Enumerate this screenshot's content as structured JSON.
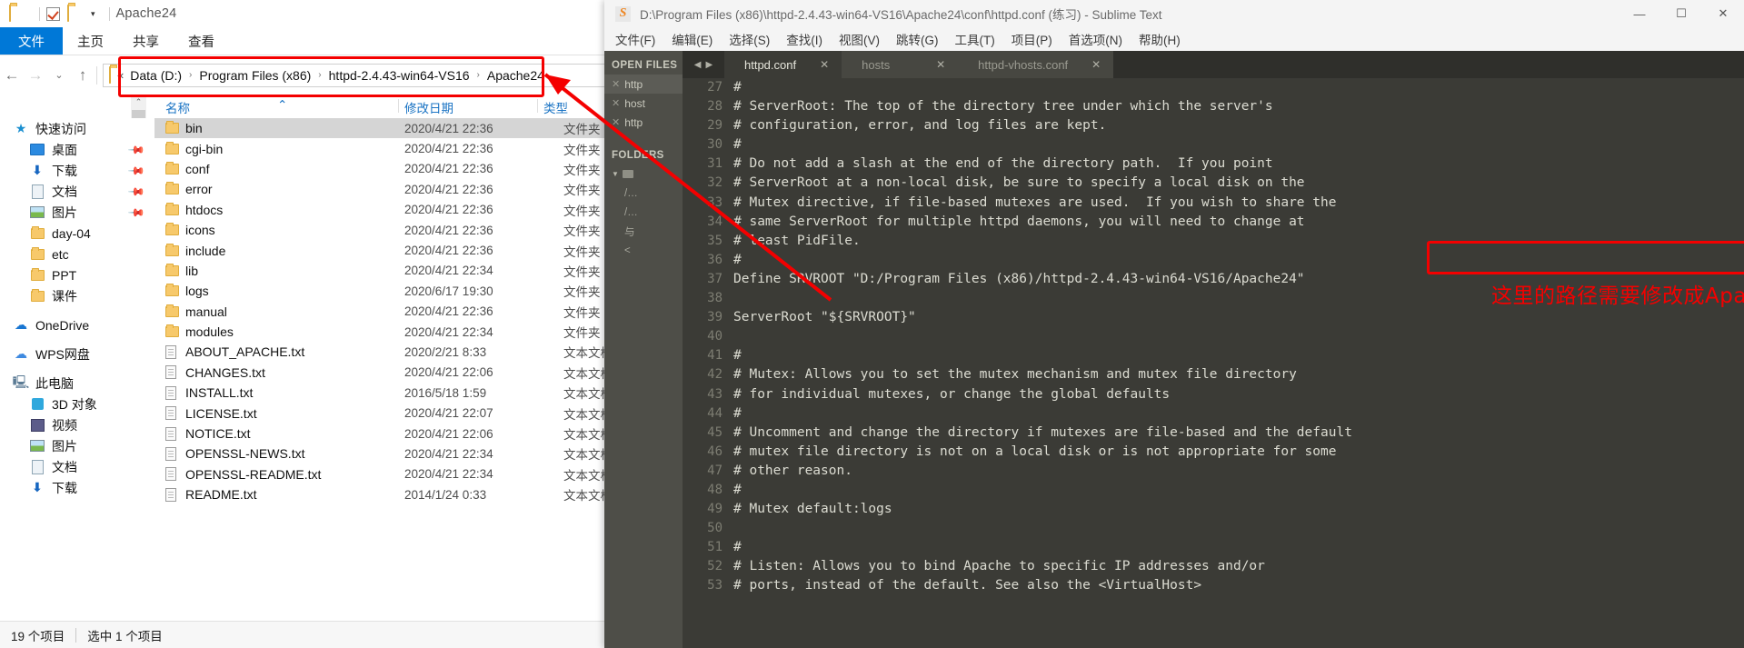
{
  "explorer": {
    "quick_access_toolbar": {
      "title": "Apache24"
    },
    "ribbon_tabs": [
      {
        "label": "文件",
        "active": true
      },
      {
        "label": "主页",
        "active": false
      },
      {
        "label": "共享",
        "active": false
      },
      {
        "label": "查看",
        "active": false
      }
    ],
    "address_bar": {
      "lead": "«",
      "crumbs": [
        "Data (D:)",
        "Program Files (x86)",
        "httpd-2.4.43-win64-VS16",
        "Apache24"
      ],
      "separator": "›",
      "dropdown": "⌄",
      "back": "←",
      "forward": "→",
      "recent": "⌄",
      "up": "↑"
    },
    "columns": {
      "name": "名称",
      "date": "修改日期",
      "type": "类型"
    },
    "nav_pane": [
      {
        "label": "快速访问",
        "icon": "star-icon",
        "level": 1,
        "pinned": false
      },
      {
        "label": "桌面",
        "icon": "desktop-icon",
        "level": 2,
        "pinned": true
      },
      {
        "label": "下载",
        "icon": "download-icon",
        "level": 2,
        "pinned": true
      },
      {
        "label": "文档",
        "icon": "document-icon",
        "level": 2,
        "pinned": true
      },
      {
        "label": "图片",
        "icon": "pictures-icon",
        "level": 2,
        "pinned": true
      },
      {
        "label": "day-04",
        "icon": "folder-icon",
        "level": 2,
        "pinned": false
      },
      {
        "label": "etc",
        "icon": "folder-icon",
        "level": 2,
        "pinned": false
      },
      {
        "label": "PPT",
        "icon": "folder-icon",
        "level": 2,
        "pinned": false
      },
      {
        "label": "课件",
        "icon": "folder-icon",
        "level": 2,
        "pinned": false
      },
      {
        "label": "OneDrive",
        "icon": "onedrive-icon",
        "level": 1,
        "pinned": false
      },
      {
        "label": "WPS网盘",
        "icon": "wps-cloud-icon",
        "level": 1,
        "pinned": false
      },
      {
        "label": "此电脑",
        "icon": "this-pc-icon",
        "level": 1,
        "pinned": false
      },
      {
        "label": "3D 对象",
        "icon": "3d-objects-icon",
        "level": 2,
        "pinned": false
      },
      {
        "label": "视频",
        "icon": "videos-icon",
        "level": 2,
        "pinned": false
      },
      {
        "label": "图片",
        "icon": "pictures-icon",
        "level": 2,
        "pinned": false
      },
      {
        "label": "文档",
        "icon": "document-icon",
        "level": 2,
        "pinned": false
      },
      {
        "label": "下载",
        "icon": "download-icon",
        "level": 2,
        "pinned": false
      }
    ],
    "files": [
      {
        "name": "bin",
        "date": "2020/4/21 22:36",
        "type": "文件夹",
        "kind": "folder",
        "selected": true
      },
      {
        "name": "cgi-bin",
        "date": "2020/4/21 22:36",
        "type": "文件夹",
        "kind": "folder",
        "selected": false
      },
      {
        "name": "conf",
        "date": "2020/4/21 22:36",
        "type": "文件夹",
        "kind": "folder",
        "selected": false
      },
      {
        "name": "error",
        "date": "2020/4/21 22:36",
        "type": "文件夹",
        "kind": "folder",
        "selected": false
      },
      {
        "name": "htdocs",
        "date": "2020/4/21 22:36",
        "type": "文件夹",
        "kind": "folder",
        "selected": false
      },
      {
        "name": "icons",
        "date": "2020/4/21 22:36",
        "type": "文件夹",
        "kind": "folder",
        "selected": false
      },
      {
        "name": "include",
        "date": "2020/4/21 22:36",
        "type": "文件夹",
        "kind": "folder",
        "selected": false
      },
      {
        "name": "lib",
        "date": "2020/4/21 22:34",
        "type": "文件夹",
        "kind": "folder",
        "selected": false
      },
      {
        "name": "logs",
        "date": "2020/6/17 19:30",
        "type": "文件夹",
        "kind": "folder",
        "selected": false
      },
      {
        "name": "manual",
        "date": "2020/4/21 22:36",
        "type": "文件夹",
        "kind": "folder",
        "selected": false
      },
      {
        "name": "modules",
        "date": "2020/4/21 22:34",
        "type": "文件夹",
        "kind": "folder",
        "selected": false
      },
      {
        "name": "ABOUT_APACHE.txt",
        "date": "2020/2/21 8:33",
        "type": "文本文档",
        "kind": "file",
        "selected": false
      },
      {
        "name": "CHANGES.txt",
        "date": "2020/4/21 22:06",
        "type": "文本文档",
        "kind": "file",
        "selected": false
      },
      {
        "name": "INSTALL.txt",
        "date": "2016/5/18 1:59",
        "type": "文本文档",
        "kind": "file",
        "selected": false
      },
      {
        "name": "LICENSE.txt",
        "date": "2020/4/21 22:07",
        "type": "文本文档",
        "kind": "file",
        "selected": false
      },
      {
        "name": "NOTICE.txt",
        "date": "2020/4/21 22:06",
        "type": "文本文档",
        "kind": "file",
        "selected": false
      },
      {
        "name": "OPENSSL-NEWS.txt",
        "date": "2020/4/21 22:34",
        "type": "文本文档",
        "kind": "file",
        "selected": false
      },
      {
        "name": "OPENSSL-README.txt",
        "date": "2020/4/21 22:34",
        "type": "文本文档",
        "kind": "file",
        "selected": false
      },
      {
        "name": "README.txt",
        "date": "2014/1/24 0:33",
        "type": "文本文档",
        "kind": "file",
        "selected": false
      }
    ],
    "status_bar": {
      "count": "19 个项目",
      "selection": "选中 1 个项目"
    }
  },
  "sublime": {
    "title": "D:\\Program Files (x86)\\httpd-2.4.43-win64-VS16\\Apache24\\conf\\httpd.conf (练习) - Sublime Text",
    "window_buttons": {
      "minimize": "—",
      "maximize": "☐",
      "close": "✕"
    },
    "menu": [
      "文件(F)",
      "编辑(E)",
      "选择(S)",
      "查找(I)",
      "视图(V)",
      "跳转(G)",
      "工具(T)",
      "项目(P)",
      "首选项(N)",
      "帮助(H)"
    ],
    "sidebar": {
      "open_files_header": "OPEN FILES",
      "open_files": [
        {
          "label": "http",
          "active": true
        },
        {
          "label": "host",
          "active": false
        },
        {
          "label": "http",
          "active": false
        }
      ],
      "folders_header": "FOLDERS",
      "folder_rows": [
        "",
        "/…",
        "/…",
        "与",
        "<"
      ]
    },
    "tabs": [
      {
        "label": "httpd.conf",
        "active": true,
        "close": "✕"
      },
      {
        "label": "hosts",
        "active": false,
        "close": "✕"
      },
      {
        "label": "httpd-vhosts.conf",
        "active": false,
        "close": "✕"
      }
    ],
    "tab_arrows": {
      "left": "◀",
      "right": "▶"
    },
    "first_line_number": 27,
    "code_lines": [
      "#",
      "# ServerRoot: The top of the directory tree under which the server's",
      "# configuration, error, and log files are kept.",
      "#",
      "# Do not add a slash at the end of the directory path.  If you point",
      "# ServerRoot at a non-local disk, be sure to specify a local disk on the",
      "# Mutex directive, if file-based mutexes are used.  If you wish to share the",
      "# same ServerRoot for multiple httpd daemons, you will need to change at",
      "# least PidFile.",
      "#",
      "Define SRVROOT \"D:/Program Files (x86)/httpd-2.4.43-win64-VS16/Apache24\"",
      "",
      "ServerRoot \"${SRVROOT}\"",
      "",
      "#",
      "# Mutex: Allows you to set the mutex mechanism and mutex file directory",
      "# for individual mutexes, or change the global defaults",
      "#",
      "# Uncomment and change the directory if mutexes are file-based and the default",
      "# mutex file directory is not on a local disk or is not appropriate for some",
      "# other reason.",
      "#",
      "# Mutex default:logs",
      "",
      "#",
      "# Listen: Allows you to bind Apache to specific IP addresses and/or",
      "# ports, instead of the default. See also the <VirtualHost>"
    ],
    "annotation": {
      "note_text": "这里的路径需要修改成Apache所在的文件路径",
      "highlight_color": "#f40000"
    }
  }
}
